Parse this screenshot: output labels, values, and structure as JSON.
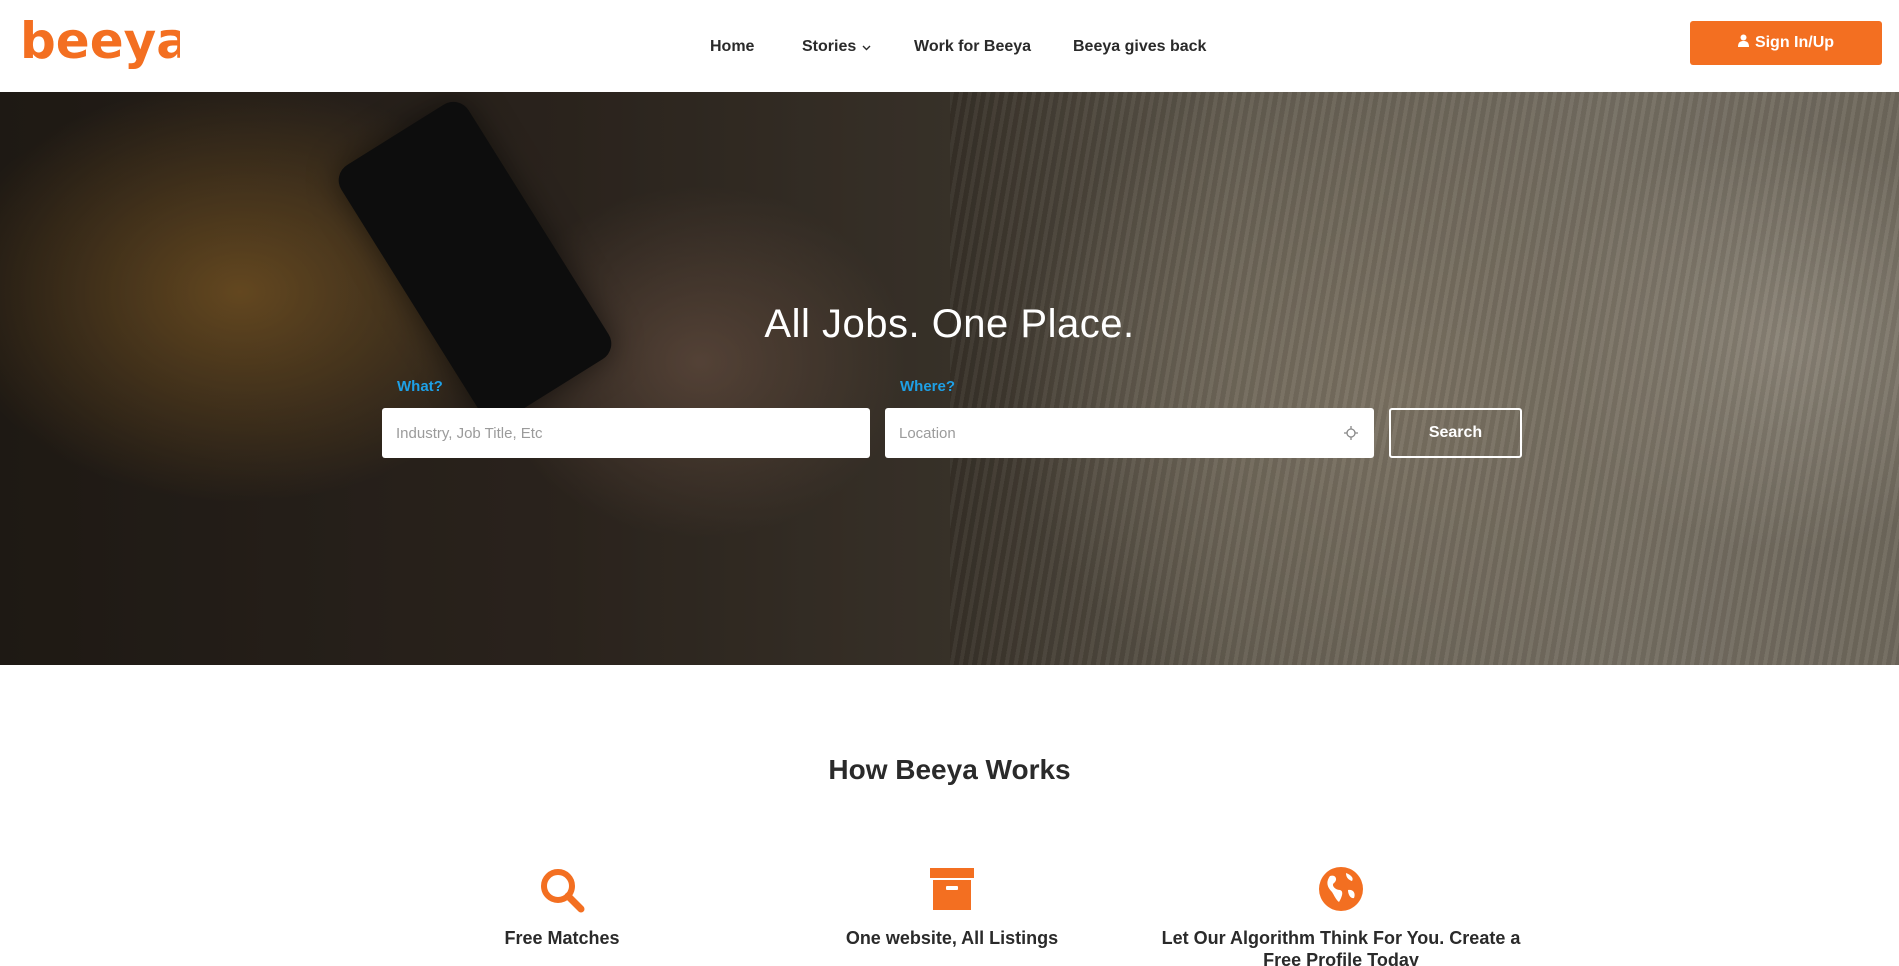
{
  "brand": {
    "logo_text": "beeya",
    "accent_color": "#f36f21"
  },
  "nav": {
    "items": [
      {
        "label": "Home"
      },
      {
        "label": "Stories",
        "has_dropdown": true
      },
      {
        "label": "Work for Beeya"
      },
      {
        "label": "Beeya gives back"
      }
    ],
    "signin_label": "Sign In/Up",
    "signin_icon": "user-icon"
  },
  "hero": {
    "title": "All Jobs. One Place.",
    "what_label": "What?",
    "what_placeholder": "Industry, Job Title, Etc",
    "what_value": "",
    "where_label": "Where?",
    "where_placeholder": "Location",
    "where_value": "",
    "where_icon": "locate-icon",
    "search_label": "Search",
    "label_color": "#1ea0e6"
  },
  "how_it_works": {
    "title": "How Beeya Works",
    "features": [
      {
        "icon": "search-icon",
        "title": "Free Matches"
      },
      {
        "icon": "archive-box-icon",
        "title": "One website, All Listings"
      },
      {
        "icon": "globe-icon",
        "title": "Let Our Algorithm Think For You. Create a Free Profile Today"
      }
    ]
  }
}
